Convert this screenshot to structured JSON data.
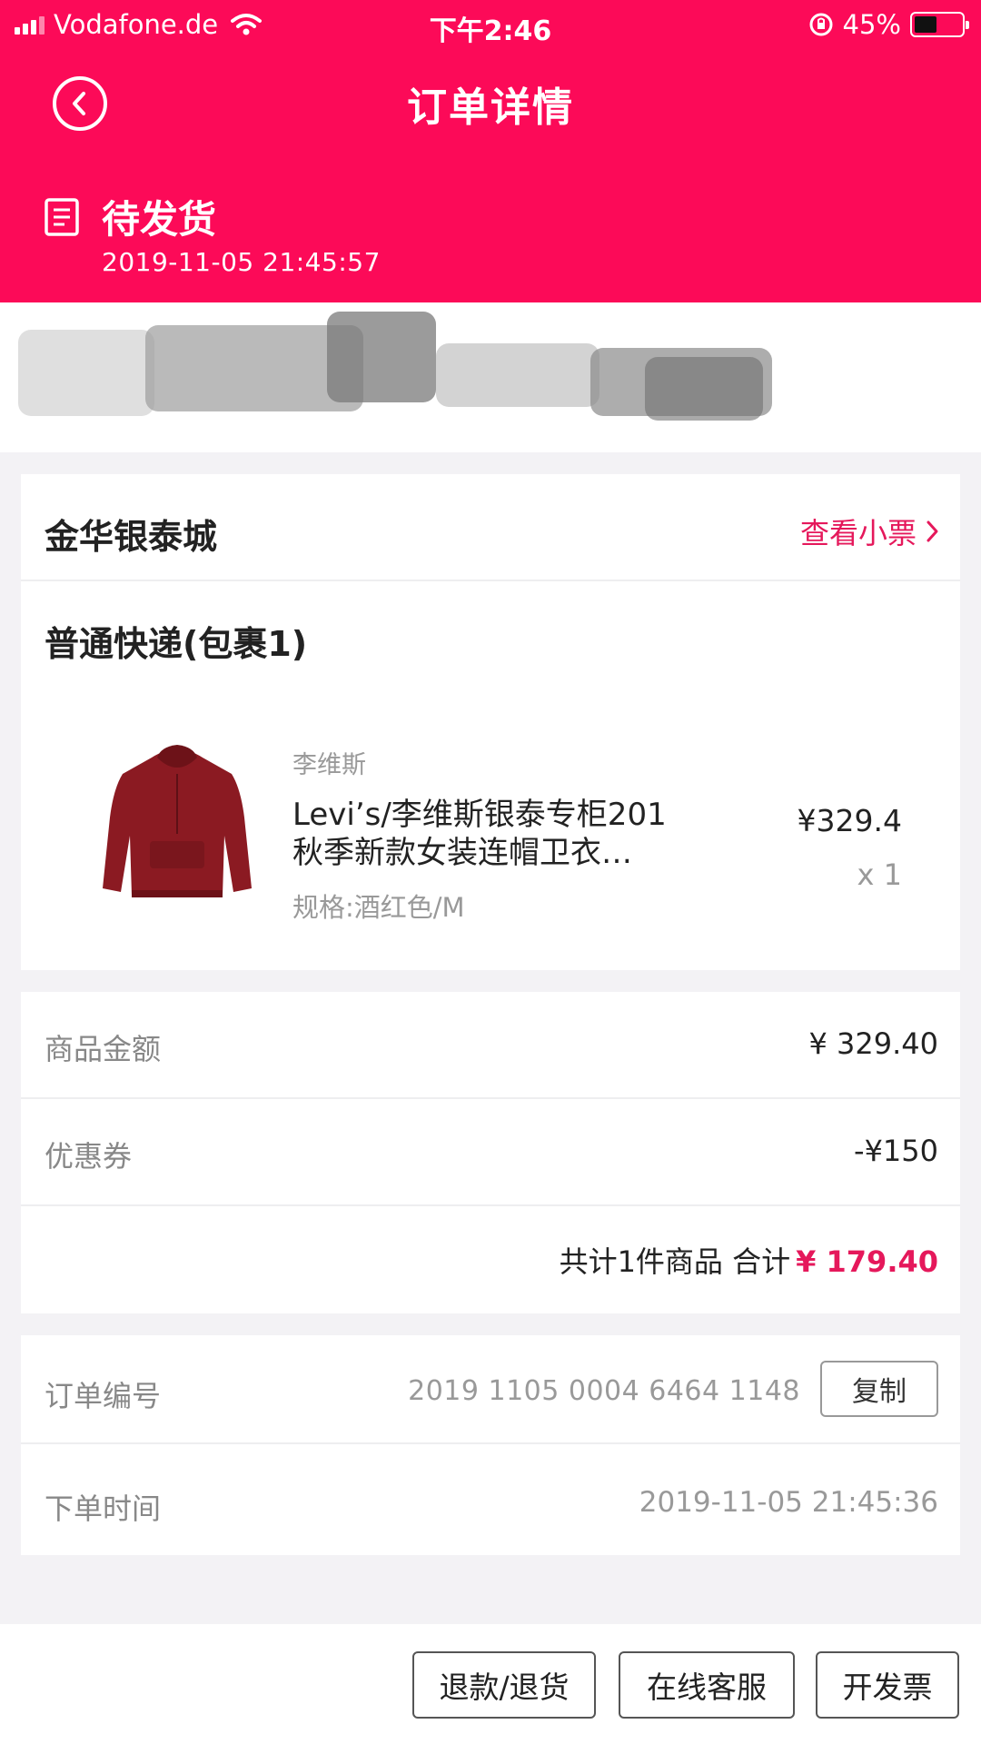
{
  "status_bar": {
    "carrier": "Vodafone.de",
    "time": "下午2:46",
    "battery_pct": "45%"
  },
  "nav": {
    "title": "订单详情",
    "back_icon": "chevron-left-circle-icon"
  },
  "order": {
    "status": "待发货",
    "status_time": "2019-11-05 21:45:57",
    "status_icon": "document-icon"
  },
  "shop": {
    "name": "金华银泰城",
    "receipt_link": "查看小票"
  },
  "package": {
    "delivery_type": "普通快递(包裹1)",
    "item": {
      "brand": "李维斯",
      "title": "Levi’s/李维斯银泰专柜201秋季新款女装连帽卫衣…",
      "spec": "规格:酒红色/M",
      "price": "¥329.4",
      "quantity": "x 1",
      "image": "burgundy hoodie"
    }
  },
  "summary": {
    "goods_label": "商品金额",
    "goods_value": "¥ 329.40",
    "coupon_label": "优惠券",
    "coupon_value": "-¥150",
    "total_prefix": "共计1件商品 合计",
    "total_value": "¥ 179.40"
  },
  "info": {
    "order_no_label": "订单编号",
    "order_no": "2019 1105 0004 6464 1148",
    "copy_label": "复制",
    "order_time_label": "下单时间",
    "order_time": "2019-11-05 21:45:36"
  },
  "actions": {
    "refund": "退款/退货",
    "service": "在线客服",
    "invoice": "开发票"
  },
  "colors": {
    "brand": "#fc0a58",
    "accent_text": "#e5185b",
    "background": "#f3f2f5"
  }
}
